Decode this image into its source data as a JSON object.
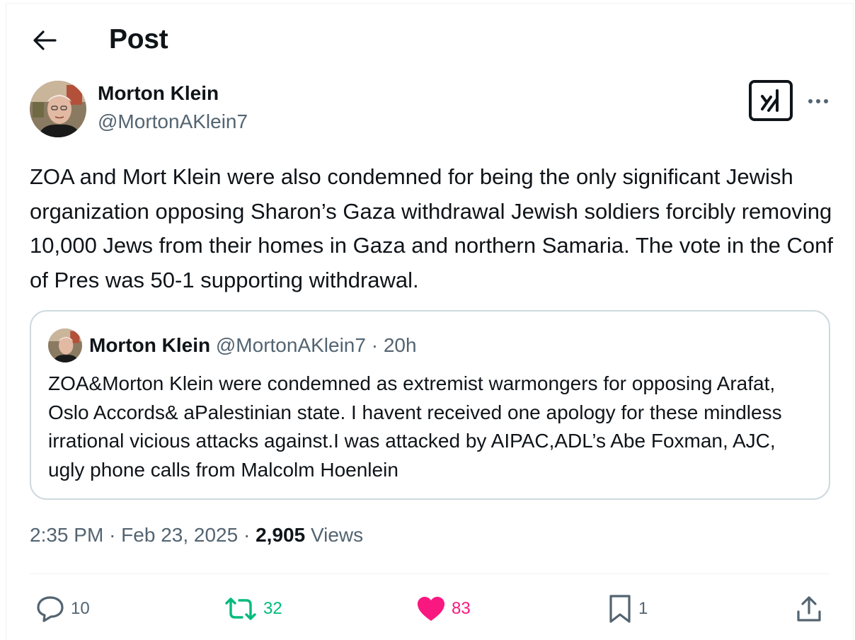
{
  "header": {
    "title": "Post"
  },
  "post": {
    "author_name": "Morton Klein",
    "author_handle": "@MortonAKlein7",
    "text": "ZOA and Mort Klein were also condemned for being the only significant Jewish organization opposing Sharon’s Gaza withdrawal Jewish soldiers forcibly removing 10,000 Jews from their homes in Gaza and northern Samaria. The vote in the Conf of Pres was 50-1 supporting withdrawal.",
    "time": "2:35 PM",
    "date": "Feb 23, 2025",
    "separator": "·",
    "views_count": "2,905",
    "views_label": "Views"
  },
  "quoted": {
    "author_name": "Morton Klein",
    "author_handle": "@MortonAKlein7",
    "separator": "·",
    "time": "20h",
    "text": "ZOA&Morton Klein were condemned as extremist warmongers for opposing Arafat, Oslo Accords& aPalestinian state. I havent received one apology for these mindless irrational vicious attacks against.I was attacked by AIPAC,ADL’s Abe Foxman, AJC, ugly phone calls from Malcolm Hoenlein"
  },
  "actions": {
    "replies": "10",
    "reposts": "32",
    "likes": "83",
    "bookmarks": "1"
  },
  "icons": [
    "back-arrow-icon",
    "grok-icon",
    "more-icon",
    "reply-icon",
    "repost-icon",
    "like-icon",
    "bookmark-icon",
    "share-icon"
  ],
  "colors": {
    "text_primary": "#0f1419",
    "text_secondary": "#536471",
    "repost_green": "#00ba7c",
    "like_pink": "#f91880",
    "border": "#cfd9de"
  }
}
